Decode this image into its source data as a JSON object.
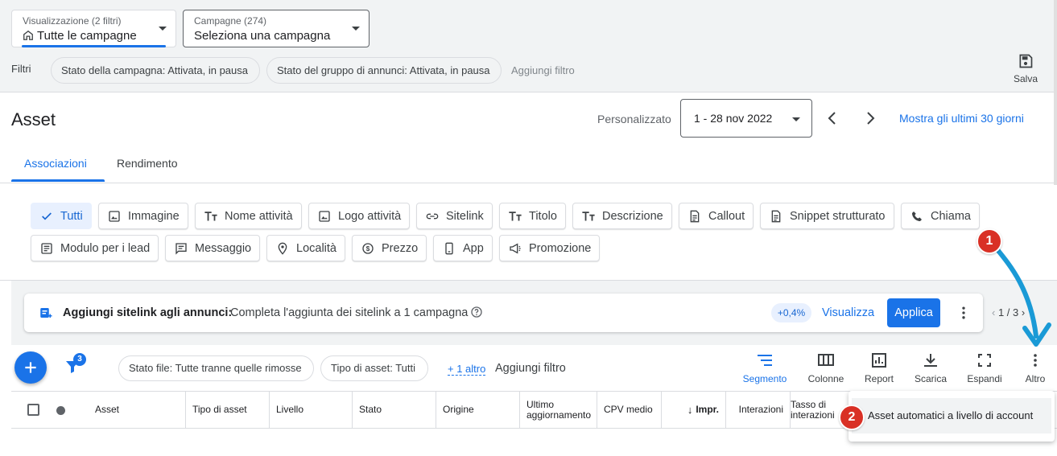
{
  "header": {
    "view_picker": {
      "label": "Visualizzazione (2 filtri)",
      "value": "Tutte le campagne",
      "icon": "home-icon"
    },
    "campaign_picker": {
      "label": "Campagne (274)",
      "value": "Seleziona una campagna"
    },
    "filters_label": "Filtri",
    "filter_chips": [
      "Stato della campagna: Attivata, in pausa",
      "Stato del gruppo di annunci: Attivata, in pausa"
    ],
    "add_filter": "Aggiungi filtro",
    "save_label": "Salva"
  },
  "page": {
    "title": "Asset",
    "date_range_label": "Personalizzato",
    "date_range_value": "1 - 28 nov 2022",
    "last_30_link": "Mostra gli ultimi 30 giorni"
  },
  "tabs": [
    {
      "label": "Associazioni",
      "active": true
    },
    {
      "label": "Rendimento",
      "active": false
    }
  ],
  "asset_types": [
    {
      "label": "Tutti",
      "icon": "check-icon",
      "selected": true
    },
    {
      "label": "Immagine",
      "icon": "image-icon"
    },
    {
      "label": "Nome attività",
      "icon": "text-icon"
    },
    {
      "label": "Logo attività",
      "icon": "image-icon"
    },
    {
      "label": "Sitelink",
      "icon": "link-icon"
    },
    {
      "label": "Titolo",
      "icon": "text-icon"
    },
    {
      "label": "Descrizione",
      "icon": "text-icon"
    },
    {
      "label": "Callout",
      "icon": "document-icon"
    },
    {
      "label": "Snippet strutturato",
      "icon": "document-icon"
    },
    {
      "label": "Chiama",
      "icon": "phone-icon"
    },
    {
      "label": "Modulo per i lead",
      "icon": "form-icon"
    },
    {
      "label": "Messaggio",
      "icon": "message-icon"
    },
    {
      "label": "Località",
      "icon": "location-pin-icon"
    },
    {
      "label": "Prezzo",
      "icon": "price-icon"
    },
    {
      "label": "App",
      "icon": "phone-device-icon"
    },
    {
      "label": "Promozione",
      "icon": "megaphone-icon"
    }
  ],
  "recommendation": {
    "title": "Aggiungi sitelink agli annunci:",
    "description": "Completa l'aggiunta dei sitelink a 1 campagna",
    "uplift": "+0,4%",
    "view_label": "Visualizza",
    "apply_label": "Applica",
    "pager": "1 / 3"
  },
  "toolbar": {
    "filter_count": "3",
    "chips": [
      "Stato file: Tutte tranne quelle rimosse",
      "Tipo di asset: Tutti"
    ],
    "more_filters": "+ 1 altro",
    "add_filter": "Aggiungi filtro",
    "tools": [
      "Segmento",
      "Colonne",
      "Report",
      "Scarica",
      "Espandi",
      "Altro"
    ]
  },
  "table": {
    "columns": [
      "Asset",
      "Tipo di asset",
      "Livello",
      "Stato",
      "Origine",
      "Ultimo aggiornamento",
      "CPV medio",
      "Impr.",
      "Interazioni",
      "Tasso di interazioni"
    ]
  },
  "menu": {
    "items": [
      "Asset automatici a livello di account"
    ]
  },
  "annotations": {
    "step1": "1",
    "step2": "2",
    "color": "#d93025",
    "arrow_color": "#1a9ad6"
  }
}
